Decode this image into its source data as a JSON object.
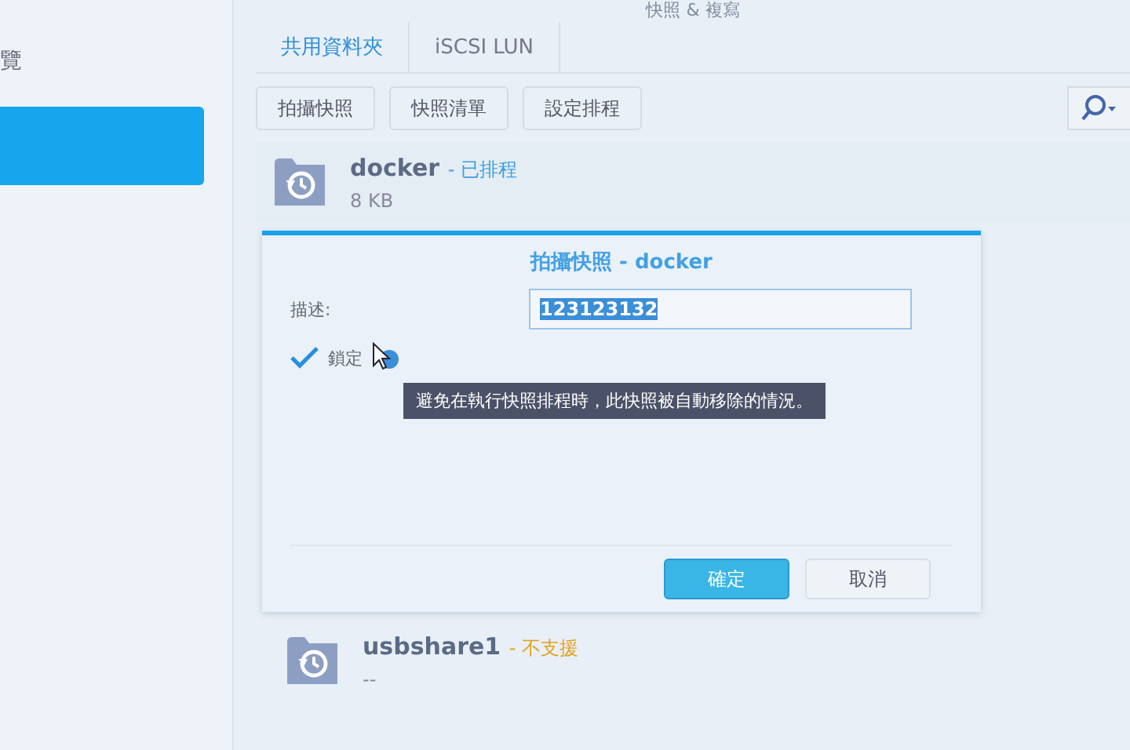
{
  "window": {
    "title": "快照 & 複寫"
  },
  "sidebar": {
    "items": [
      {
        "label": "覽",
        "selected": false
      },
      {
        "selected": true
      }
    ]
  },
  "tabs": [
    {
      "label": "共用資料夾",
      "selected": true
    },
    {
      "label": "iSCSI LUN",
      "selected": false
    }
  ],
  "toolbar": {
    "buttons": [
      "拍攝快照",
      "快照清單",
      "設定排程"
    ]
  },
  "shares": [
    {
      "name": "docker",
      "status": "- 已排程",
      "color": "#3b9ee0",
      "size": "8 KB"
    },
    {
      "name": "usbshare1",
      "status": "- 不支援",
      "color": "#e3a21a",
      "size": "--"
    }
  ],
  "dialog": {
    "title": "拍攝快照 - docker",
    "description_label": "描述:",
    "description_value": "123123132",
    "value_selected": true,
    "lock": {
      "label": "鎖定",
      "checked": true
    },
    "tooltip": "避免在執行快照排程時，此快照被自動移除的情況。",
    "buttons": [
      {
        "label": "確定",
        "kind": "primary"
      },
      {
        "label": "取消",
        "kind": "default"
      }
    ]
  }
}
